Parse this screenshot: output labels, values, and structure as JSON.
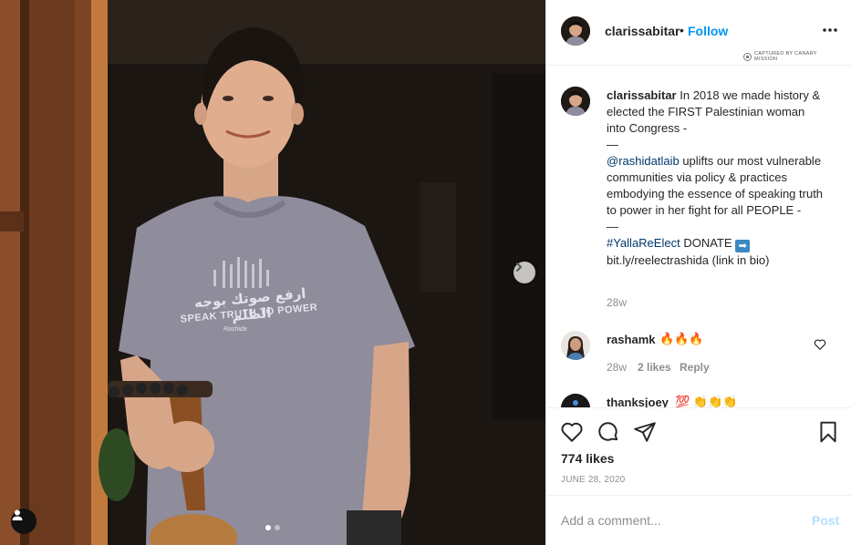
{
  "post": {
    "username": "clarissabitar",
    "separator": "•",
    "follow_label": "Follow",
    "more_icon": "more-horizontal-icon",
    "watermark": "CAPTURED BY CANARY MISSION",
    "shirt_arabic": "ارفع صوتك بوجه الظلم",
    "shirt_english": "SPEAK TRUTH TO POWER",
    "shirt_brand": "Rashida",
    "carousel_dots": 2,
    "carousel_active": 0
  },
  "caption": {
    "username": "clarissabitar",
    "line1": "In 2018 we made history & elected the FIRST Palestinian woman into Congress -",
    "dash1": "—",
    "mention": "@rashidatlaib",
    "line2": "uplifts our most vulnerable communities via policy & practices embodying the essence of speaking truth to power in her fight for all PEOPLE -",
    "dash2": "—",
    "hashtag": "#YallaReElect",
    "donate": "DONATE",
    "arrow": "➡",
    "link": "bit.ly/reelectrashida (link in bio)",
    "time": "28w"
  },
  "comments": [
    {
      "username": "rashamk",
      "text": "🔥🔥🔥",
      "time": "28w",
      "likes": "2 likes",
      "reply": "Reply"
    },
    {
      "username": "thanksjoey",
      "text": "💯 👏👏👏"
    }
  ],
  "actions": {
    "likes": "774 likes",
    "date": "JUNE 28, 2020"
  },
  "add_comment": {
    "placeholder": "Add a comment...",
    "post_label": "Post"
  },
  "colors": {
    "follow": "#0095f6",
    "link": "#00376b",
    "muted": "#8e8e8e",
    "post_disabled": "#b2dffc"
  }
}
